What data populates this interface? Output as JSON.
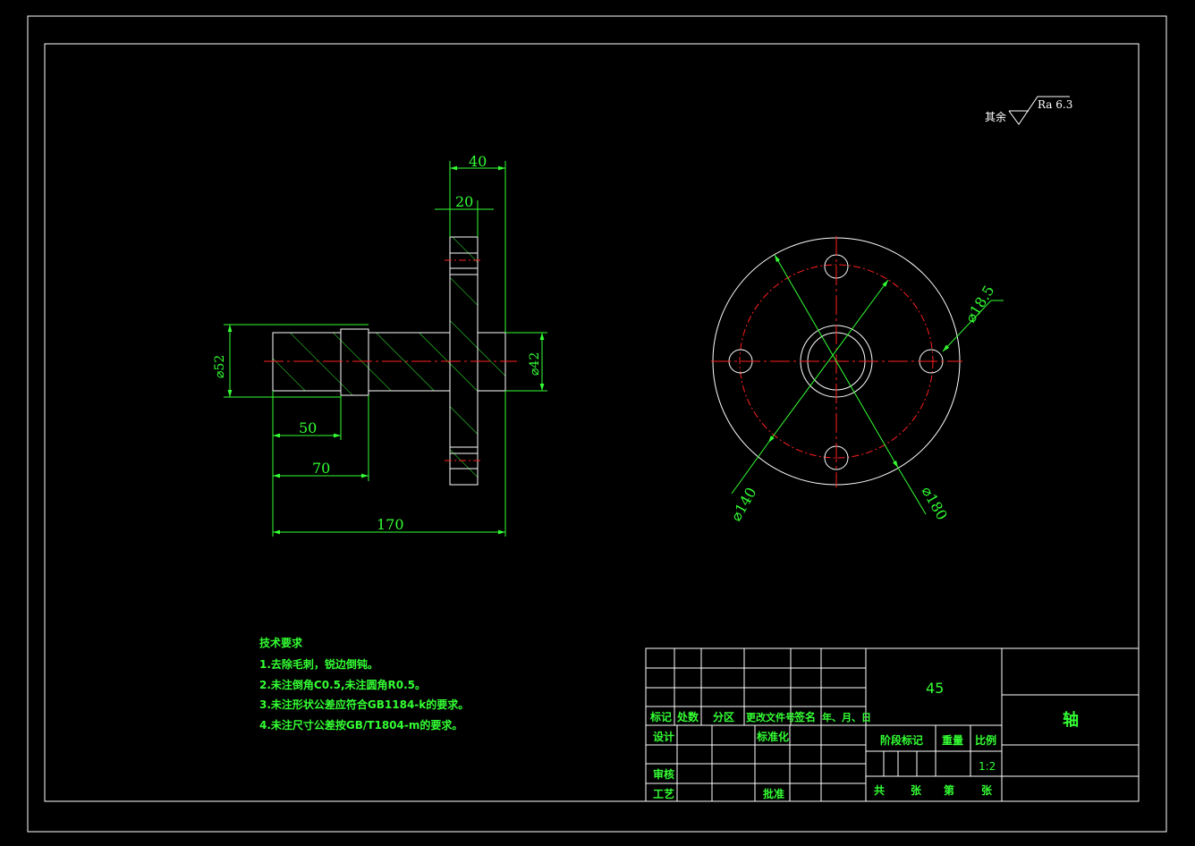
{
  "roughness": {
    "label": "其余",
    "value": "Ra 6.3"
  },
  "front_view": {
    "dims": {
      "flange_width": "40",
      "flange_thickness": "20",
      "dia_left": "⌀52",
      "dia_right": "⌀42",
      "len_50": "50",
      "len_70": "70",
      "len_170": "170"
    }
  },
  "side_view": {
    "dims": {
      "hole": "⌀18.5",
      "pcd": "⌀140",
      "outer": "⌀180"
    }
  },
  "notes": {
    "title": "技术要求",
    "items": [
      "1.去除毛刺，锐边倒钝。",
      "2.未注倒角C0.5,未注圆角R0.5。",
      "3.未注形状公差应符合GB1184-k的要求。",
      "4.未注尺寸公差按GB/T1804-m的要求。"
    ]
  },
  "title_block": {
    "material": "45",
    "part_name": "轴",
    "header": {
      "mark": "标记",
      "count": "处数",
      "zone": "分区",
      "change_doc": "更改文件号",
      "signature": "签名",
      "date": "年、月、日"
    },
    "design": "设计",
    "standardize": "标准化",
    "review": "审核",
    "process": "工艺",
    "approve": "批准",
    "stage_mark": "阶段标记",
    "weight": "重量",
    "scale_label": "比例",
    "scale_value": "1:2",
    "sheets": {
      "total": "共",
      "zhang1": "张",
      "num": "第",
      "zhang2": "张"
    }
  },
  "colors": {
    "background": "#000000",
    "outline": "#ffffff",
    "dimension": "#33ff33",
    "centerline": "#ff2020"
  }
}
